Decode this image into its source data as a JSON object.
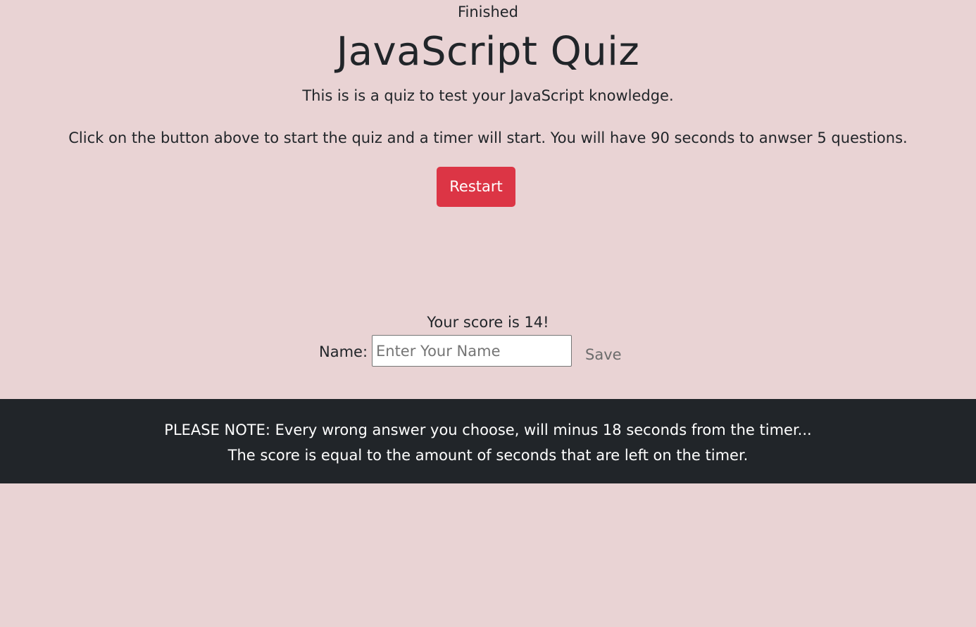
{
  "header": {
    "status": "Finished",
    "title": "JavaScript Quiz",
    "intro": "This is is a quiz to test your JavaScript knowledge.",
    "instructions": "Click on the button above to start the quiz and a timer will start. You will have 90 seconds to anwser 5 questions."
  },
  "controls": {
    "restart_label": "Restart"
  },
  "result": {
    "score_text": "Your score is 14!",
    "name_label": "Name:",
    "name_value": "",
    "name_placeholder": "Enter Your Name",
    "save_label": "Save"
  },
  "footer": {
    "note_line_1": "PLEASE NOTE: Every wrong answer you choose, will minus 18 seconds from the timer...",
    "note_line_2": "The score is equal to the amount of seconds that are left on the timer."
  },
  "colors": {
    "background": "#e9d3d4",
    "restart_button": "#dc3545",
    "footer_background": "#212529",
    "text": "#212529"
  }
}
